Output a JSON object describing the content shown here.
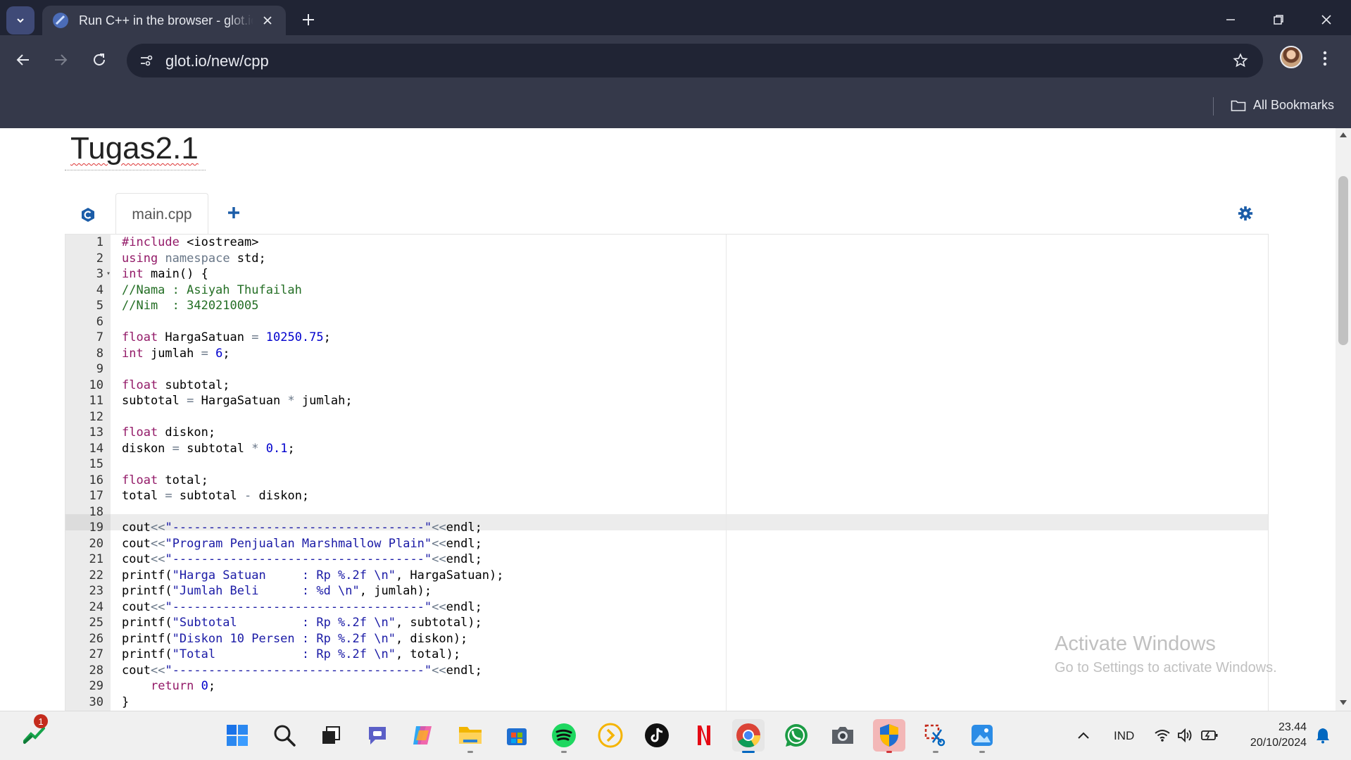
{
  "browser": {
    "tab_title": "Run C++ in the browser - glot.io",
    "url": "glot.io/new/cpp",
    "bookmarks_label": "All Bookmarks"
  },
  "snippet": {
    "title": "Tugas2.1",
    "file_tab": "main.cpp",
    "language_icon": "cpp-icon"
  },
  "editor": {
    "active_line": 19,
    "lines": [
      "#include <iostream>",
      "using namespace std;",
      "int main() {",
      "//Nama : Asiyah Thufailah",
      "//Nim  : 3420210005",
      "",
      "float HargaSatuan = 10250.75;",
      "int jumlah = 6;",
      "",
      "float subtotal;",
      "subtotal = HargaSatuan * jumlah;",
      "",
      "float diskon;",
      "diskon = subtotal * 0.1;",
      "",
      "float total;",
      "total = subtotal - diskon;",
      "",
      "cout<<\"-----------------------------------\"<<endl;",
      "cout<<\"Program Penjualan Marshmallow Plain\"<<endl;",
      "cout<<\"-----------------------------------\"<<endl;",
      "printf(\"Harga Satuan     : Rp %.2f \\n\", HargaSatuan);",
      "printf(\"Jumlah Beli      : %d \\n\", jumlah);",
      "cout<<\"-----------------------------------\"<<endl;",
      "printf(\"Subtotal         : Rp %.2f \\n\", subtotal);",
      "printf(\"Diskon 10 Persen : Rp %.2f \\n\", diskon);",
      "printf(\"Total            : Rp %.2f \\n\", total);",
      "cout<<\"-----------------------------------\"<<endl;",
      "    return 0;",
      "}"
    ]
  },
  "watermark": {
    "title": "Activate Windows",
    "subtitle": "Go to Settings to activate Windows."
  },
  "taskbar": {
    "widgets_badge": "1",
    "language": "IND",
    "time": "23.44",
    "date": "20/10/2024",
    "apps": [
      "start-icon",
      "search-icon",
      "task-view-icon",
      "chat-icon",
      "copilot-icon",
      "file-explorer-icon",
      "store-icon",
      "spotify-icon",
      "plex-icon",
      "tiktok-icon",
      "netflix-icon",
      "chrome-icon",
      "whatsapp-icon",
      "camera-icon",
      "security-icon",
      "snipping-tool-icon",
      "photos-icon"
    ]
  },
  "colors": {
    "chrome_dark": "#202434",
    "chrome_toolbar": "#35394a",
    "keyword": "#931a68",
    "string": "#1a1aa6",
    "number": "#0000cd",
    "comment": "#236e24",
    "glot_blue": "#1c5da8"
  }
}
